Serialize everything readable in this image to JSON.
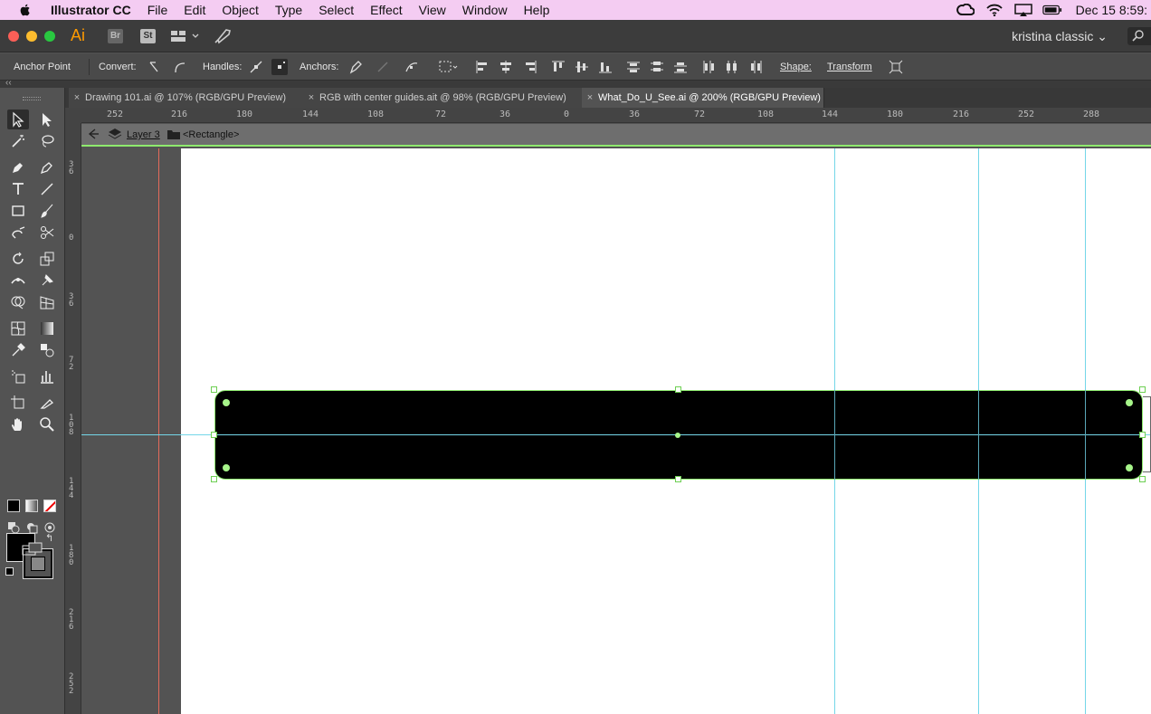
{
  "menubar": {
    "app_name": "Illustrator CC",
    "items": [
      "File",
      "Edit",
      "Object",
      "Type",
      "Select",
      "Effect",
      "View",
      "Window",
      "Help"
    ],
    "clock": "Dec 15  8:59:"
  },
  "appbar": {
    "logo": "Ai",
    "bridge": "Br",
    "stock": "St",
    "workspace": "kristina classic"
  },
  "controlbar": {
    "tool_name": "Anchor Point",
    "convert_label": "Convert:",
    "handles_label": "Handles:",
    "anchors_label": "Anchors:",
    "shape_label": "Shape:",
    "transform_label": "Transform"
  },
  "tabs": [
    {
      "title": "Drawing 101.ai @ 107% (RGB/GPU Preview)",
      "active": false
    },
    {
      "title": "RGB with center guides.ait @ 98% (RGB/GPU Preview)",
      "active": false
    },
    {
      "title": "What_Do_U_See.ai @ 200% (RGB/GPU Preview)",
      "active": true
    }
  ],
  "hruler_labels": [
    "252",
    "216",
    "180",
    "144",
    "108",
    "72",
    "36",
    "0",
    "36",
    "72",
    "108",
    "144",
    "180",
    "216",
    "252",
    "288"
  ],
  "vruler_labels": [
    "36",
    "0",
    "36",
    "72",
    "108",
    "144",
    "180",
    "216",
    "252"
  ],
  "isolation": {
    "layer": "Layer 3",
    "object": "<Rectangle>"
  },
  "colors": {
    "accent_selection": "#8eea6e",
    "guide": "#74d6e8",
    "fill": "#000000",
    "menubar": "#f4ccf2"
  }
}
